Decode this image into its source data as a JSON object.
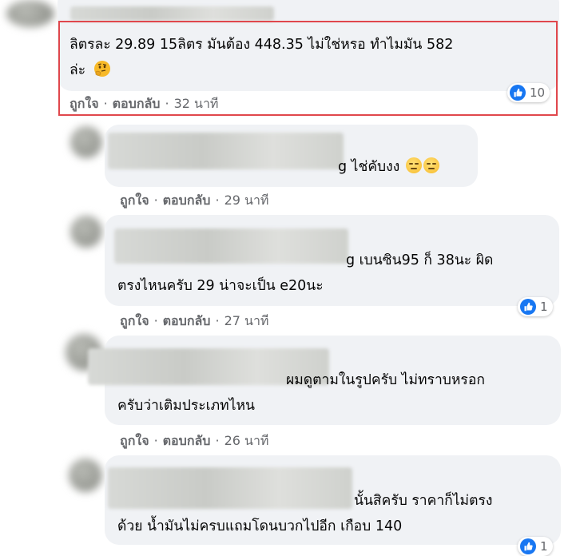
{
  "comments": [
    {
      "text_lines": [
        "ลิตรละ 29.89 15ลิตร มันต้อง 448.35 ไม่ใช่หรอ ทำไมมัน 582",
        "ล่ะ"
      ],
      "emoji": "thinking-face",
      "actions": {
        "like": "ถูกใจ",
        "reply": "ตอบกลับ"
      },
      "time": "32 นาที",
      "reactions": {
        "count": "10"
      }
    },
    {
      "text_lines": [
        "g ไช่คับงง"
      ],
      "emoji": "neutral-face",
      "actions": {
        "like": "ถูกใจ",
        "reply": "ตอบกลับ"
      },
      "time": "29 นาที"
    },
    {
      "text_lines": [
        "g เบนซิน95 ก็ 38นะ ผิด",
        "ตรงไหนครับ 29 น่าจะเป็น e20นะ"
      ],
      "actions": {
        "like": "ถูกใจ",
        "reply": "ตอบกลับ"
      },
      "time": "27 นาที",
      "reactions": {
        "count": "1"
      }
    },
    {
      "text_lines": [
        "ผมดูตามในรูปครับ ไม่ทราบหรอก",
        "ครับว่าเติมประเภทไหน"
      ],
      "actions": {
        "like": "ถูกใจ",
        "reply": "ตอบกลับ"
      },
      "time": "26 นาที"
    },
    {
      "text_lines": [
        "นั้นสิครับ ราคาก็ไม่ตรง",
        "ด้วย น้ำมันไม่ครบแถมโดนบวกไปอีก เกือบ 140"
      ],
      "reactions": {
        "count": "1"
      }
    }
  ],
  "colors": {
    "accent": "#1877f2",
    "highlight": "#e0474c",
    "bubble": "#f0f2f5",
    "meta": "#65676b"
  }
}
